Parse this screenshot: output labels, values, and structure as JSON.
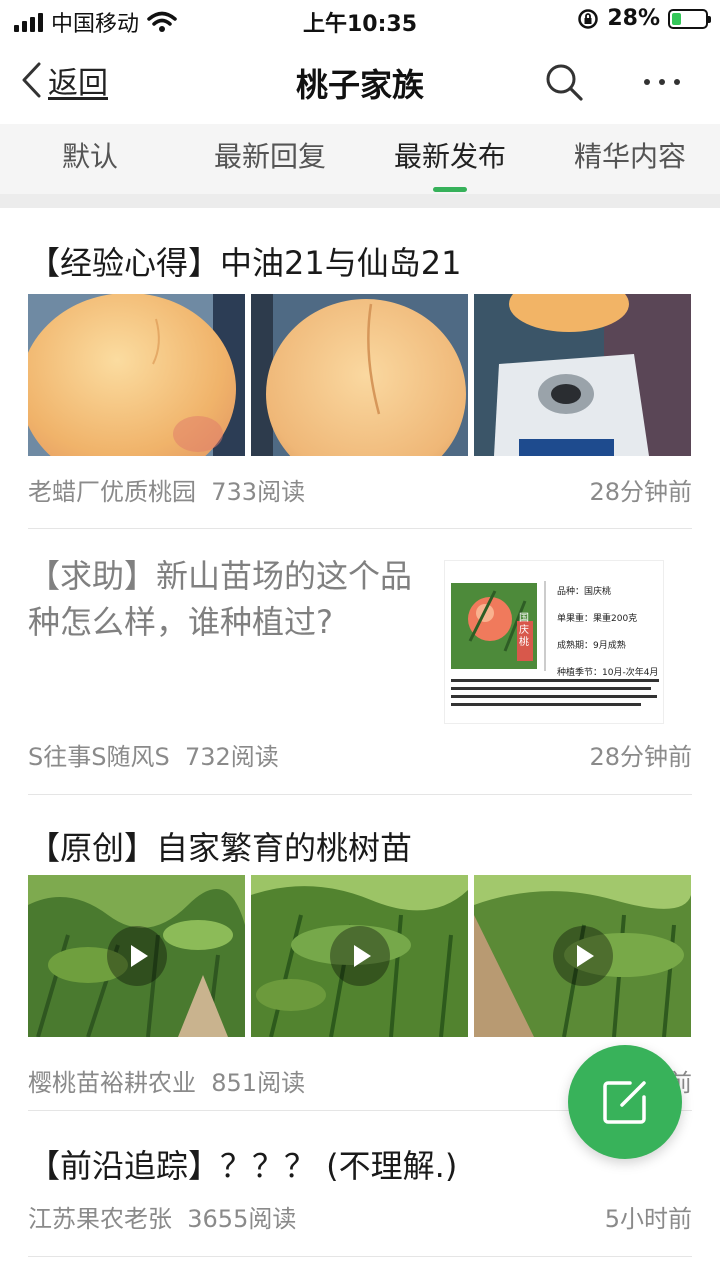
{
  "status_bar": {
    "carrier": "中国移动",
    "time": "上午10:35",
    "battery_text": "28%",
    "battery_level": 0.28
  },
  "nav": {
    "back_label": "返回",
    "title": "桃子家族",
    "icons": {
      "back": "chevron-left-icon",
      "search": "search-icon",
      "more": "more-dots-icon"
    }
  },
  "tabs": [
    {
      "label": "默认",
      "active": false
    },
    {
      "label": "最新回复",
      "active": false
    },
    {
      "label": "最新发布",
      "active": true
    },
    {
      "label": "精华内容",
      "active": false
    }
  ],
  "posts": [
    {
      "title": "【经验心得】中油21与仙岛21",
      "author": "老蜡厂优质桃园",
      "reads": "733阅读",
      "time": "28分钟前"
    },
    {
      "title": "【求助】新山苗场的这个品种怎么样，谁种植过?",
      "author": "S往事S随风S",
      "reads": "732阅读",
      "time": "28分钟前",
      "doc": {
        "label": "国庆桃",
        "lines": [
          "品种：国庆桃",
          "单果重：果重200克",
          "成熟期：9月成熟",
          "种植季节：10月-次年4月"
        ]
      }
    },
    {
      "title": "【原创】自家繁育的桃树苗",
      "author": "樱桃苗裕耕农业",
      "reads": "851阅读",
      "time": "28分钟前"
    },
    {
      "title": "【前沿追踪】？？？ (不理解.)",
      "author": "江苏果农老张",
      "reads": "3655阅读",
      "time": "5小时前"
    }
  ],
  "fab": {
    "icon": "compose-icon"
  },
  "colors": {
    "accent": "#36b15a",
    "fab": "#38b25a",
    "meta": "#8a8a8a"
  }
}
